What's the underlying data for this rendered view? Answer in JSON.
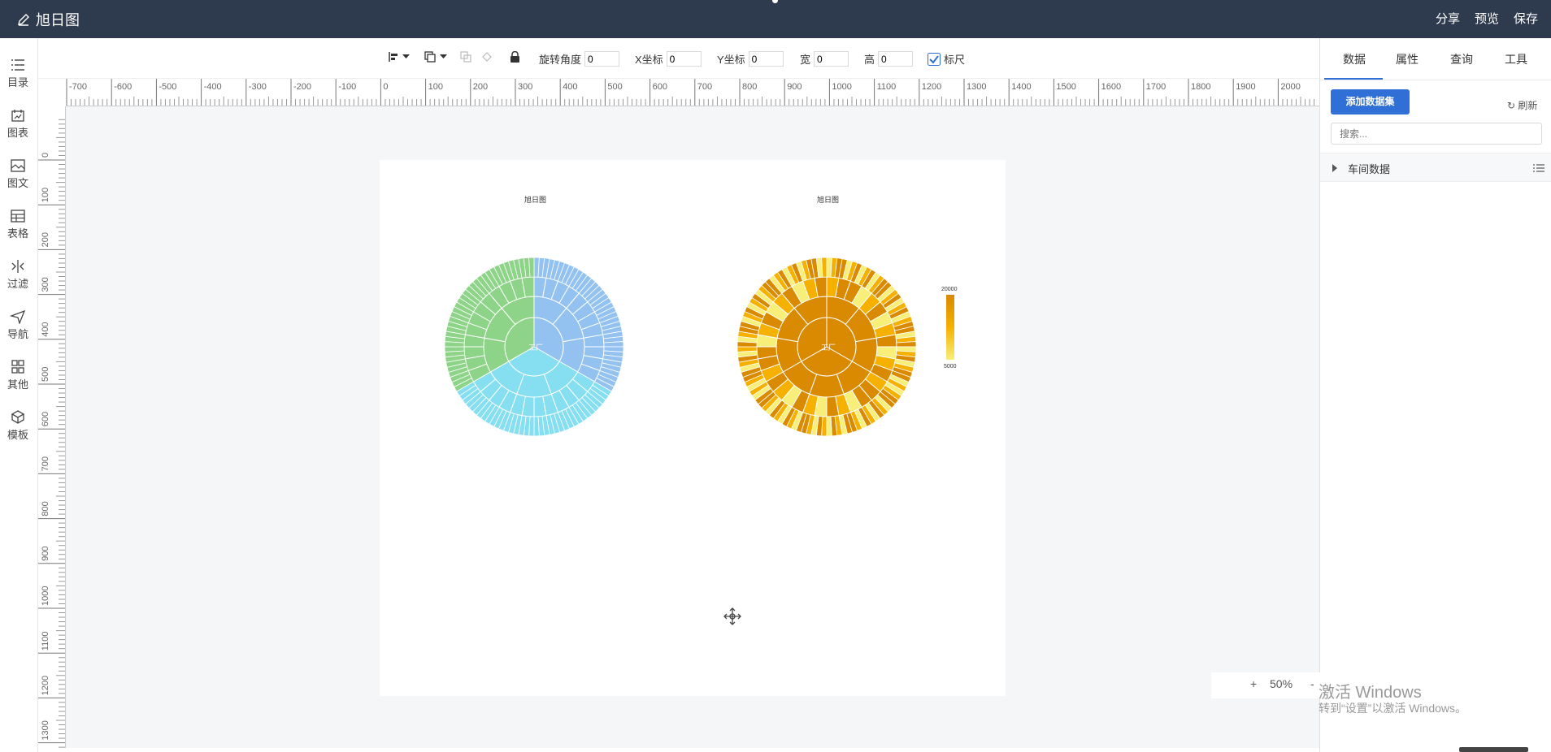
{
  "app": {
    "title": "旭日图"
  },
  "header": {
    "share": "分享",
    "preview": "预览",
    "save": "保存"
  },
  "sidebar": {
    "items": [
      {
        "label": "目录",
        "icon": "list-icon"
      },
      {
        "label": "图表",
        "icon": "chart-icon"
      },
      {
        "label": "图文",
        "icon": "image-text-icon"
      },
      {
        "label": "表格",
        "icon": "table-icon"
      },
      {
        "label": "过滤",
        "icon": "filter-icon"
      },
      {
        "label": "导航",
        "icon": "navigation-icon"
      },
      {
        "label": "其他",
        "icon": "grid-icon"
      },
      {
        "label": "模板",
        "icon": "template-icon"
      }
    ]
  },
  "toolbar": {
    "rotate_label": "旋转角度",
    "rotate_value": "0",
    "x_label": "X坐标",
    "x_value": "0",
    "y_label": "Y坐标",
    "y_value": "0",
    "w_label": "宽",
    "w_value": "0",
    "h_label": "高",
    "h_value": "0",
    "ruler_label": "标尺",
    "ruler_checked": true
  },
  "ruler": {
    "h_ticks": [
      "-700",
      "-600",
      "-500",
      "-400",
      "-300",
      "-200",
      "-100",
      "0",
      "100",
      "200",
      "300",
      "400",
      "500",
      "600",
      "700",
      "800",
      "900",
      "1000",
      "1100",
      "1200",
      "1300",
      "1400",
      "1500",
      "1600",
      "1700",
      "1800",
      "1900",
      "2000"
    ],
    "v_ticks": [
      "0",
      "100",
      "200",
      "300",
      "400",
      "500",
      "600",
      "700",
      "800",
      "900",
      "1000",
      "1100",
      "1200",
      "1300"
    ]
  },
  "chart_data": [
    {
      "type": "sunburst",
      "title": "旭日图",
      "center": "工厂",
      "colors": [
        "#93c2f1",
        "#86dff0",
        "#8dd488"
      ]
    },
    {
      "type": "sunburst",
      "title": "旭日图",
      "center": "工厂",
      "visual_map": {
        "min": 5000,
        "max": 20000,
        "colors": [
          "#f7ef7a",
          "#f5b000",
          "#d98a00"
        ]
      }
    }
  ],
  "right_panel": {
    "tabs": [
      "数据",
      "属性",
      "查询",
      "工具"
    ],
    "active_tab": "数据",
    "add_dataset": "添加数据集",
    "refresh": "刷新",
    "search_placeholder": "搜索...",
    "datasets": [
      "车间数据"
    ]
  },
  "zoom": {
    "plus": "+",
    "value": "50%",
    "minus": "-"
  },
  "watermark": {
    "line1": "激活 Windows",
    "line2": "转到“设置”以激活 Windows。"
  }
}
